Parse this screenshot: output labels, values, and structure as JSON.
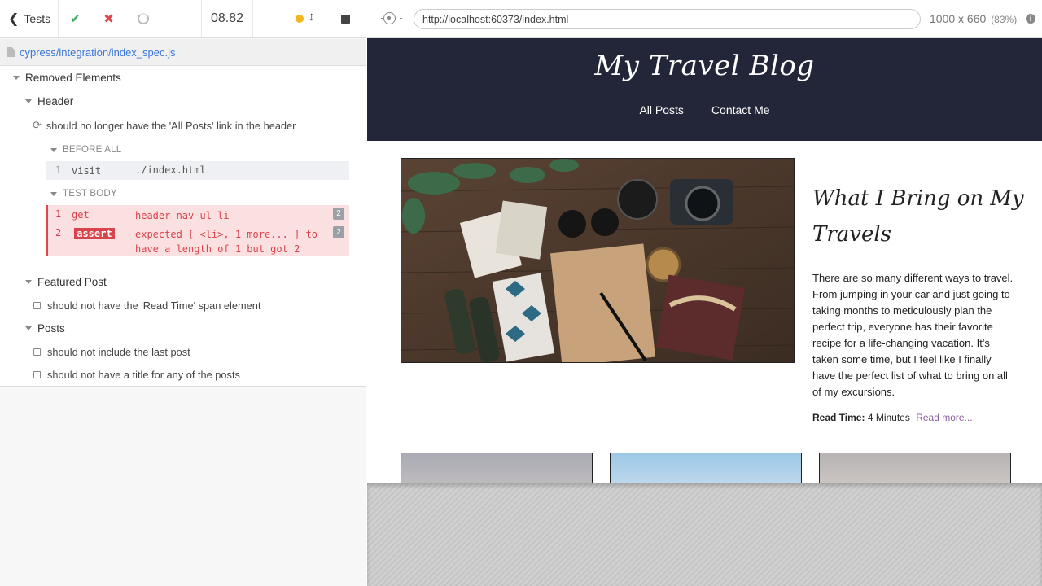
{
  "runner": {
    "back_label": "Tests",
    "passed": "--",
    "failed": "--",
    "pending": "--",
    "duration": "08.82",
    "spec_path": "cypress/integration/index_spec.js"
  },
  "reporter": {
    "suite_root": "Removed Elements",
    "suite_header": "Header",
    "test_running": "should no longer have the 'All Posts' link in the header",
    "before_all_label": "BEFORE ALL",
    "before_all_cmd": {
      "num": "1",
      "name": "visit",
      "msg": "./index.html"
    },
    "test_body_label": "TEST BODY",
    "cmd_get": {
      "num": "1",
      "name": "get",
      "msg": "header nav ul li",
      "count": "2"
    },
    "cmd_assert": {
      "num": "2",
      "dash": "-",
      "name": "assert",
      "msg_line1": "expected [ <li>, 1 more... ] to",
      "msg_line2": "have a length of 1 but got 2",
      "count": "2"
    },
    "suite_featured": "Featured Post",
    "test_featured_1": "should not have the 'Read Time' span element",
    "suite_posts": "Posts",
    "test_posts_1": "should not include the last post",
    "test_posts_2": "should not have a title for any of the posts"
  },
  "browser": {
    "url": "http://localhost:60373/index.html",
    "viewport": "1000 x 660",
    "scale": "(83%)"
  },
  "site": {
    "title": "My Travel Blog",
    "nav": [
      "All Posts",
      "Contact Me"
    ],
    "post_title": "What I Bring on My Travels",
    "post_body": "There are so many different ways to travel. From jumping in your car and just going to taking months to meticulously plan the perfect trip, everyone has their favorite recipe for a life-changing vacation. It's taken some time, but I feel like I finally have the perfect list of what to bring on all of my excursions.",
    "read_time_label": "Read Time:",
    "read_time_value": "4 Minutes",
    "read_more": "Read more..."
  },
  "colors": {
    "pass": "#3aa364",
    "fail": "#e0474c",
    "header_bg": "#232638",
    "link": "#3a76d8",
    "read_more": "#8a5c9a"
  }
}
